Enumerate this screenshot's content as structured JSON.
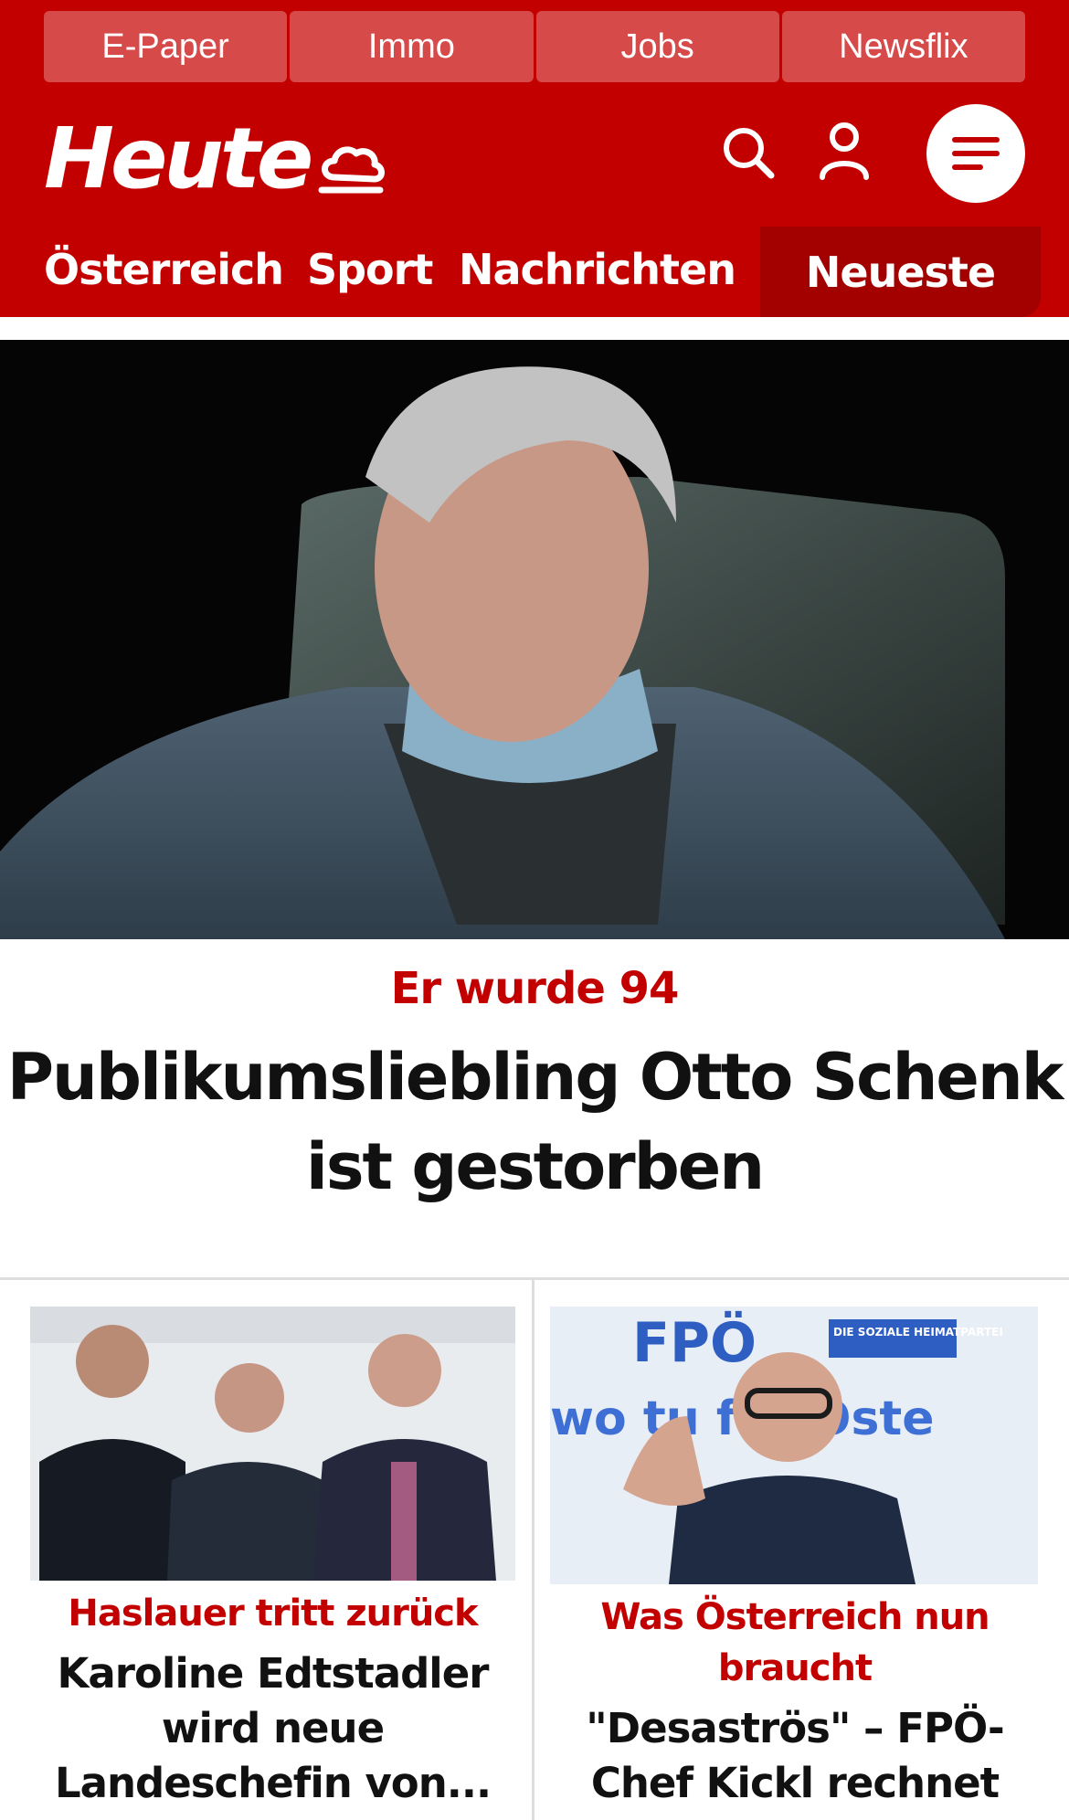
{
  "topbar": {
    "items": [
      "E-Paper",
      "Immo",
      "Jobs",
      "Newsflix"
    ]
  },
  "brand": {
    "logo": "Heute",
    "weather_icon": "cloud-icon",
    "accent": "#c20000"
  },
  "nav": {
    "items": [
      "Österreich",
      "Sport",
      "Nachrichten"
    ],
    "active": "Neueste"
  },
  "hero": {
    "kicker": "Er wurde 94",
    "headline": "Publikumsliebling Otto Schenk ist gestorben"
  },
  "cards": [
    {
      "kicker": "Haslauer tritt zurück",
      "title": "Karoline Edtstadler wird neue Landeschefin von..."
    },
    {
      "kicker": "Was Österreich nun braucht",
      "title": "\"Desaströs\" – FPÖ-Chef Kickl rechnet",
      "banner_text": "FPÖ",
      "banner_sub": "DIE SOZIALE HEIMATPARTEI",
      "banner_slogan": "wo tu für Öste"
    }
  ]
}
